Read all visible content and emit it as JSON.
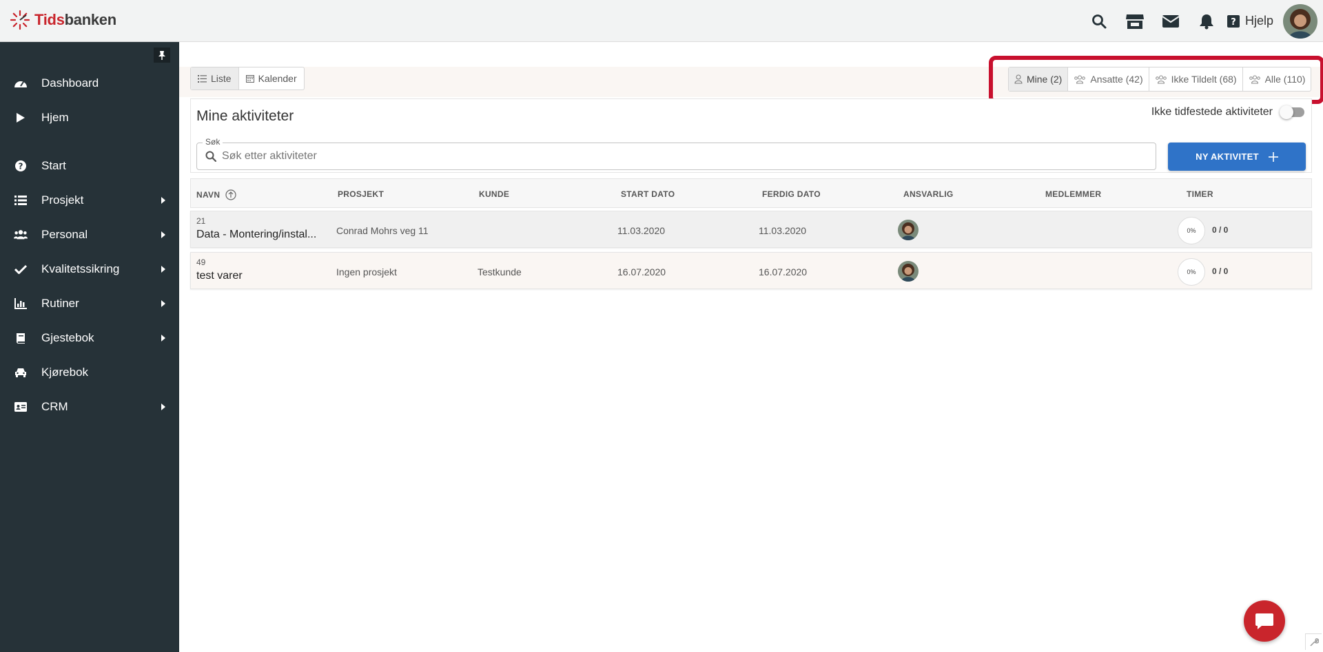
{
  "brand": {
    "logo_part1": "Tids",
    "logo_part2": "banken",
    "accent": "#c9252c"
  },
  "topbar": {
    "icons": [
      "search-icon",
      "store-icon",
      "mail-icon",
      "bell-icon"
    ],
    "help_label": "Hjelp"
  },
  "sidebar": {
    "items": [
      {
        "label": "Dashboard",
        "icon": "dashboard-icon",
        "has_submenu": false
      },
      {
        "label": "Hjem",
        "icon": "play-icon",
        "has_submenu": false
      },
      {
        "label": "Start",
        "icon": "question-icon",
        "has_submenu": false
      },
      {
        "label": "Prosjekt",
        "icon": "list-icon",
        "has_submenu": true
      },
      {
        "label": "Personal",
        "icon": "users-icon",
        "has_submenu": true
      },
      {
        "label": "Kvalitetssikring",
        "icon": "check-icon",
        "has_submenu": true
      },
      {
        "label": "Rutiner",
        "icon": "chart-icon",
        "has_submenu": true
      },
      {
        "label": "Gjestebok",
        "icon": "book-icon",
        "has_submenu": true
      },
      {
        "label": "Kjørebok",
        "icon": "car-icon",
        "has_submenu": false
      },
      {
        "label": "CRM",
        "icon": "id-card-icon",
        "has_submenu": true
      }
    ]
  },
  "view_toggle": {
    "list_label": "Liste",
    "calendar_label": "Kalender"
  },
  "filters": [
    {
      "label": "Mine (2)",
      "active": true
    },
    {
      "label": "Ansatte (42)",
      "active": false
    },
    {
      "label": "Ikke Tildelt (68)",
      "active": false
    },
    {
      "label": "Alle (110)",
      "active": false
    }
  ],
  "activities": {
    "title": "Mine aktiviteter",
    "unscheduled_label": "Ikke tidfestede aktiviteter",
    "search_legend": "Søk",
    "search_placeholder": "Søk etter aktiviteter",
    "new_button_label": "NY AKTIVITET"
  },
  "table": {
    "columns": [
      "NAVN",
      "PROSJEKT",
      "KUNDE",
      "START DATO",
      "FERDIG DATO",
      "ANSVARLIG",
      "MEDLEMMER",
      "TIMER"
    ],
    "rows": [
      {
        "number": "21",
        "name": "Data - Montering/instal...",
        "project": "Conrad Mohrs veg 11",
        "customer": "",
        "start": "11.03.2020",
        "end": "11.03.2020",
        "progress": "0%",
        "hours": "0 / 0",
        "bg": "#f0f0f0"
      },
      {
        "number": "49",
        "name": "test varer",
        "project": "Ingen prosjekt",
        "customer": "Testkunde",
        "start": "16.07.2020",
        "end": "16.07.2020",
        "progress": "0%",
        "hours": "0 / 0",
        "bg": "#faf6f3"
      }
    ]
  }
}
